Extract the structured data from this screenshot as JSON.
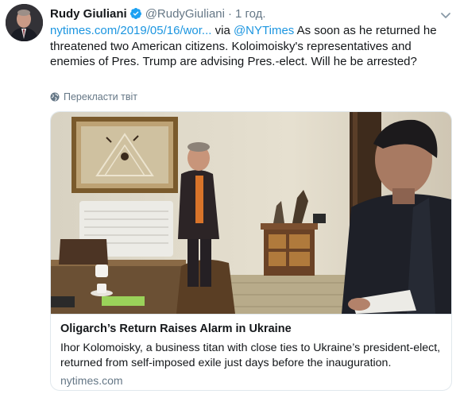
{
  "tweet": {
    "display_name": "Rudy Giuliani",
    "handle": "@RudyGiuliani",
    "separator": "·",
    "time": "1 год.",
    "link_text": "nytimes.com/2019/05/16/wor...",
    "via_text": " via ",
    "via_handle": "@NYTimes",
    "body_text": "As soon as he returned he threatened two American citizens. Koloimoisky's representatives and enemies of Pres. Trump are advising Pres.-elect. Will he be arrested?",
    "translate_label": "Перекласти твіт"
  },
  "card": {
    "title": "Oligarch’s Return Raises Alarm in Ukraine",
    "description": "Ihor Kolomoisky, a business titan with close ties to Ukraine’s president-elect, returned from self-imposed exile just days before the inauguration.",
    "domain": "nytimes.com"
  },
  "icons": {
    "verified": "verified-badge-icon",
    "caret": "chevron-down-icon",
    "translate": "globe-icon"
  },
  "colors": {
    "link": "#1b95e0",
    "secondary_text": "#657786",
    "border": "#e1e8ed",
    "verified": "#1da1f2"
  }
}
